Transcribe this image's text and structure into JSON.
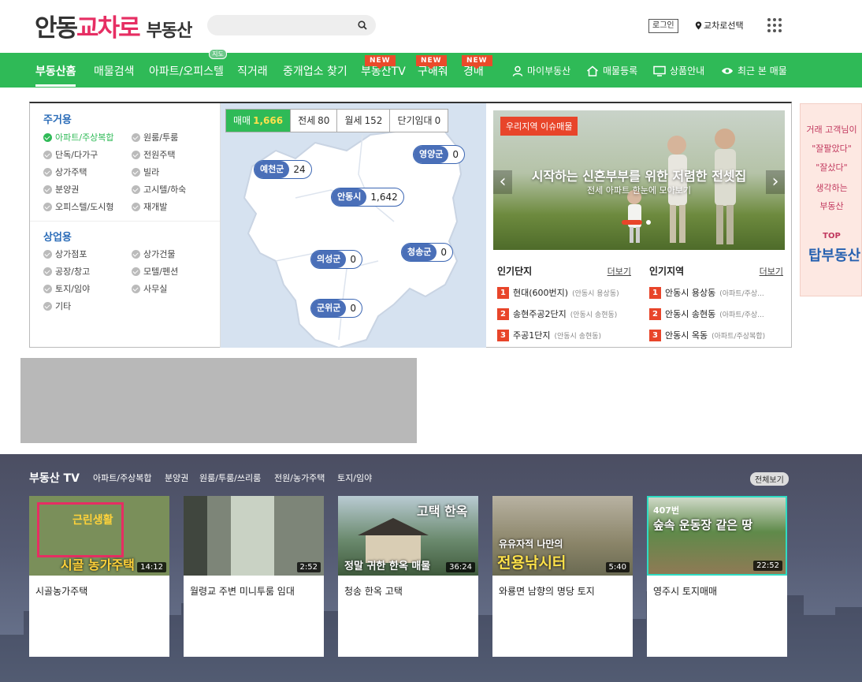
{
  "header": {
    "logo": {
      "part1": "안동",
      "part2": "교차로",
      "part3": "부동산"
    },
    "search": {
      "placeholder": ""
    },
    "login_label": "로그인",
    "location_label": "교차로선택"
  },
  "nav": {
    "items": [
      {
        "label": "부동산홈"
      },
      {
        "label": "매물검색"
      },
      {
        "label": "아파트/오피스텔",
        "badge": "지도"
      },
      {
        "label": "직거래"
      },
      {
        "label": "중개업소 찾기"
      },
      {
        "label": "부동산TV",
        "badge": "NEW"
      },
      {
        "label": "구해줘",
        "badge": "NEW"
      },
      {
        "label": "경매",
        "badge": "NEW"
      }
    ],
    "right": [
      {
        "label": "마이부동산",
        "icon": "person-icon"
      },
      {
        "label": "매물등록",
        "icon": "home-icon"
      },
      {
        "label": "상품안내",
        "icon": "monitor-icon"
      },
      {
        "label": "최근 본 매물",
        "icon": "eye-icon"
      }
    ]
  },
  "categories": {
    "residential": {
      "title": "주거용",
      "options": [
        "아파트/주상복합",
        "원룸/투룸",
        "단독/다가구",
        "전원주택",
        "상가주택",
        "빌라",
        "분양권",
        "고시텔/하숙",
        "오피스텔/도시형",
        "재개발"
      ]
    },
    "commercial": {
      "title": "상업용",
      "options": [
        "상가점포",
        "상가건물",
        "공장/창고",
        "모텔/펜션",
        "토지/임야",
        "사무실",
        "기타"
      ]
    }
  },
  "map": {
    "tabs": [
      {
        "label": "매매",
        "count": "1,666"
      },
      {
        "label": "전세",
        "count": "80"
      },
      {
        "label": "월세",
        "count": "152"
      },
      {
        "label": "단기임대",
        "count": "0"
      }
    ],
    "regions": [
      {
        "name": "영양군",
        "count": "0"
      },
      {
        "name": "예천군",
        "count": "24"
      },
      {
        "name": "안동시",
        "count": "1,642"
      },
      {
        "name": "청송군",
        "count": "0"
      },
      {
        "name": "의성군",
        "count": "0"
      },
      {
        "name": "군위군",
        "count": "0"
      }
    ]
  },
  "slider": {
    "tag": "우리지역 이슈매물",
    "title": "시작하는 신혼부부를 위한 저렴한 전셋집",
    "subtitle": "전세 아파트 한눈에 모아보기"
  },
  "popular_complex": {
    "title": "인기단지",
    "more": "더보기",
    "items": [
      {
        "rank": "1",
        "name": "현대(600번지)",
        "sub": "(안동시 용상동)"
      },
      {
        "rank": "2",
        "name": "송현주공2단지",
        "sub": "(안동시 송현동)"
      },
      {
        "rank": "3",
        "name": "주공1단지",
        "sub": "(안동시 송현동)"
      }
    ]
  },
  "popular_region": {
    "title": "인기지역",
    "more": "더보기",
    "items": [
      {
        "rank": "1",
        "name": "안동시 용상동",
        "sub": "(아파트/주상..."
      },
      {
        "rank": "2",
        "name": "안동시 송현동",
        "sub": "(아파트/주상..."
      },
      {
        "rank": "3",
        "name": "안동시 옥동",
        "sub": "(아파트/주상복합)"
      }
    ]
  },
  "side_ad": {
    "lines": [
      "거래 고객님이",
      "\"잘팔았다\"",
      "\"잘샀다\"",
      "생각하는",
      "부동산"
    ],
    "logo_top": "TOP",
    "logo": "탑부동산"
  },
  "tv": {
    "title": "부동산 TV",
    "tabs": [
      "아파트/주상복합",
      "분양권",
      "원룸/투룸/쓰리룸",
      "전원/농가주택",
      "토지/임야"
    ],
    "all_label": "전체보기",
    "videos": [
      {
        "caption": "시골농가주택",
        "duration": "14:12",
        "overlay_text": "시골 농가주택",
        "top_text": "근린생활",
        "bg": "#7a8f5a"
      },
      {
        "caption": "월령교 주변 미니투룸 임대",
        "duration": "2:52",
        "overlay_text": "",
        "top_text": "",
        "bg": "#7d8578"
      },
      {
        "caption": "청송 한옥 고택",
        "duration": "36:24",
        "overlay_text": "정말 귀한 한옥 매물",
        "top_text": "고택 한옥",
        "bg": "#6b8a6e"
      },
      {
        "caption": "와룡면 남향의 명당 토지",
        "duration": "5:40",
        "overlay_text": "전용낚시터",
        "top_text": "유유자적 나만의",
        "bg": "#8a8468"
      },
      {
        "caption": "영주시 토지매매",
        "duration": "22:52",
        "overlay_text": "숲속 운동장 같은 땅",
        "top_text": "407번",
        "bg": "#5f8a4a"
      }
    ]
  },
  "colors": {
    "nav_green": "#2fba57",
    "brand_pink": "#e62e63",
    "badge_red": "#ea4b2a",
    "region_blue": "#4a6fb8"
  }
}
